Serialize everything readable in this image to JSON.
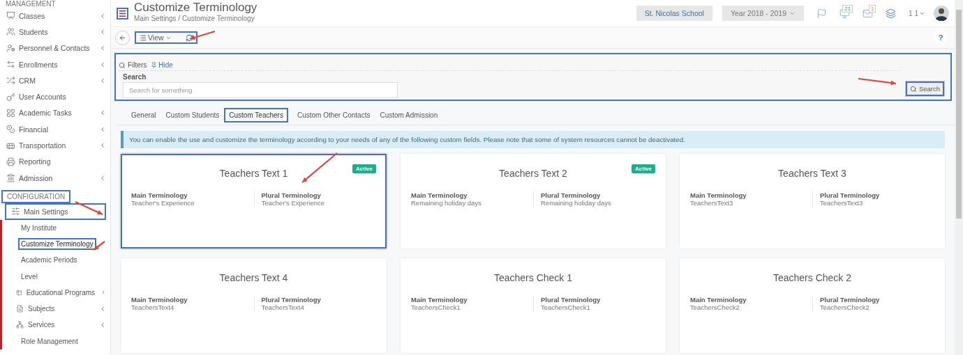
{
  "sidebar": {
    "sections": [
      {
        "title": "MANAGEMENT",
        "highlighted": false,
        "items": [
          {
            "label": "Classes",
            "expandable": true,
            "expanded": false,
            "highlighted": false
          },
          {
            "label": "Students",
            "expandable": true,
            "expanded": false,
            "highlighted": false
          },
          {
            "label": "Personnel & Contacts",
            "expandable": true,
            "expanded": false,
            "highlighted": false
          },
          {
            "label": "Enrollments",
            "expandable": true,
            "expanded": false,
            "highlighted": false
          },
          {
            "label": "CRM",
            "expandable": true,
            "expanded": false,
            "highlighted": false
          },
          {
            "label": "User Accounts",
            "expandable": false,
            "expanded": false,
            "highlighted": false
          },
          {
            "label": "Academic Tasks",
            "expandable": true,
            "expanded": false,
            "highlighted": false
          },
          {
            "label": "Financial",
            "expandable": true,
            "expanded": false,
            "highlighted": false
          },
          {
            "label": "Transportation",
            "expandable": true,
            "expanded": false,
            "highlighted": false
          },
          {
            "label": "Reporting",
            "expandable": false,
            "expanded": false,
            "highlighted": false
          },
          {
            "label": "Admission",
            "expandable": true,
            "expanded": false,
            "highlighted": false
          }
        ]
      },
      {
        "title": "CONFIGURATION",
        "highlighted": true,
        "items": [
          {
            "label": "Main Settings",
            "expandable": true,
            "expanded": true,
            "highlighted": true,
            "children": [
              {
                "label": "My Institute",
                "kind": "plain",
                "expandable": false,
                "selected": false,
                "highlighted": false
              },
              {
                "label": "Customize Terminology",
                "kind": "plain",
                "expandable": false,
                "selected": true,
                "highlighted": true
              },
              {
                "label": "Academic Periods",
                "kind": "plain",
                "expandable": false,
                "selected": false,
                "highlighted": false
              },
              {
                "label": "Level",
                "kind": "plain",
                "expandable": false,
                "selected": false,
                "highlighted": false
              },
              {
                "label": "Educational Programs",
                "kind": "icon",
                "expandable": true,
                "selected": false,
                "highlighted": false
              },
              {
                "label": "Subjects",
                "kind": "icon",
                "expandable": true,
                "selected": false,
                "highlighted": false
              },
              {
                "label": "Services",
                "kind": "icon",
                "expandable": true,
                "selected": false,
                "highlighted": false
              },
              {
                "label": "Role Management",
                "kind": "plain",
                "expandable": false,
                "selected": false,
                "highlighted": false
              }
            ]
          }
        ]
      }
    ]
  },
  "header": {
    "menu_highlighted": true,
    "title": "Customize Terminology",
    "breadcrumb": "Main Settings /  Customize Terminology",
    "school": "St. Nicolas School",
    "year": "Year 2018 - 2019",
    "notifications": "21",
    "messages": "1",
    "user": "1 1"
  },
  "toolbar": {
    "highlighted": true,
    "view": "View",
    "help": "?"
  },
  "filters": {
    "highlighted": true,
    "title": "Filters",
    "hide": "Hide",
    "label": "Search",
    "placeholder": "Search for something",
    "button": "Search",
    "button_highlighted": true
  },
  "tabs": [
    {
      "label": "General",
      "selected": false
    },
    {
      "label": "Custom Students",
      "selected": false
    },
    {
      "label": "Custom Teachers",
      "selected": true
    },
    {
      "label": "Custom Other Contacts",
      "selected": false
    },
    {
      "label": "Custom Admission",
      "selected": false
    }
  ],
  "info": "You can enable the use and customize the terminology according to your needs of any of the following custom fields. Please note that some of system resources cannot be deactivated.",
  "cards": [
    {
      "title": "Teachers Text 1",
      "active": true,
      "badge": "Active",
      "highlighted": true,
      "main_label": "Main Terminology",
      "main_value": "Teacher's Experience",
      "plural_label": "Plural Terminology",
      "plural_value": "Teacher's Experience"
    },
    {
      "title": "Teachers Text 2",
      "active": true,
      "badge": "Active",
      "highlighted": false,
      "main_label": "Main Terminology",
      "main_value": "Remaining holiday days",
      "plural_label": "Plural Terminology",
      "plural_value": "Remaining holiday days"
    },
    {
      "title": "Teachers Text 3",
      "active": false,
      "highlighted": false,
      "main_label": "Main Terminology",
      "main_value": "TeachersText3",
      "plural_label": "Plural Terminology",
      "plural_value": "TeachersText3"
    },
    {
      "title": "Teachers Text 4",
      "active": false,
      "highlighted": false,
      "main_label": "Main Terminology",
      "main_value": "TeachersText4",
      "plural_label": "Plural Terminology",
      "plural_value": "TeachersText4"
    },
    {
      "title": "Teachers Check 1",
      "active": false,
      "highlighted": false,
      "main_label": "Main Terminology",
      "main_value": "TeachersCheck1",
      "plural_label": "Plural Terminology",
      "plural_value": "TeachersCheck1"
    },
    {
      "title": "Teachers Check 2",
      "active": false,
      "highlighted": false,
      "main_label": "Main Terminology",
      "main_value": "TeachersCheck2",
      "plural_label": "Plural Terminology",
      "plural_value": "TeachersCheck2"
    }
  ]
}
